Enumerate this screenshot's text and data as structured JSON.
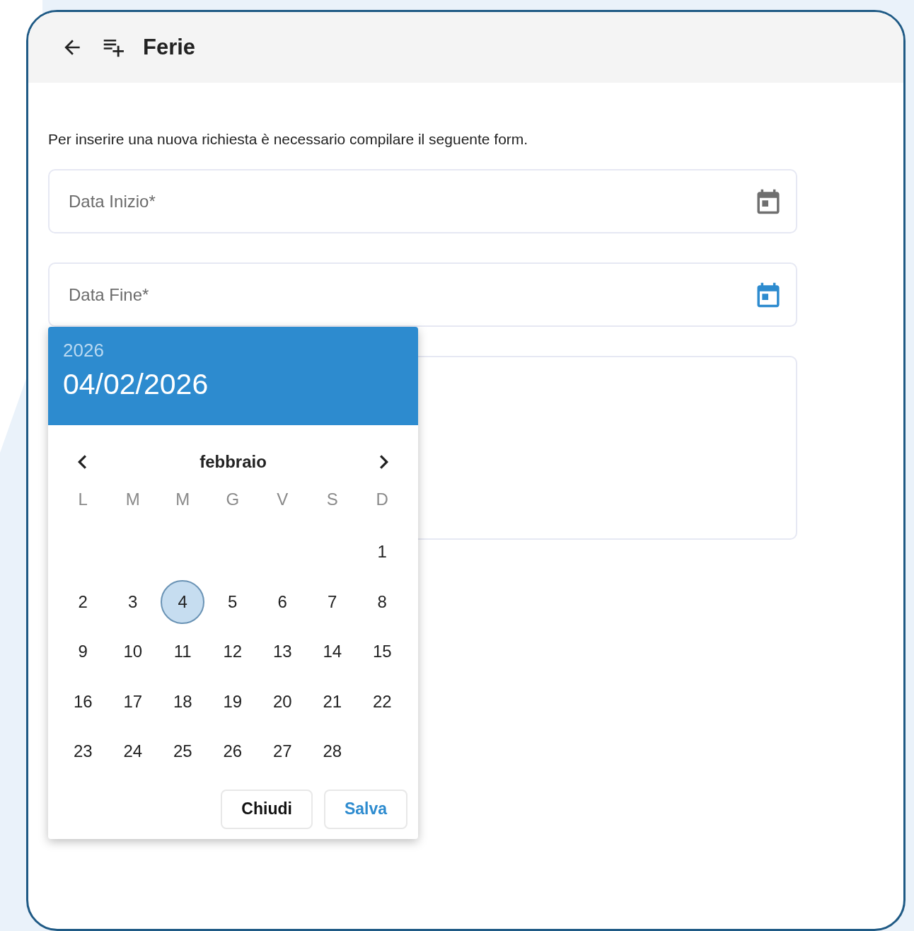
{
  "header": {
    "title": "Ferie"
  },
  "intro": "Per inserire una nuova richiesta è necessario compilare il seguente form.",
  "fields": [
    {
      "kind": "date",
      "placeholder": "Data Inizio*",
      "focused": false
    },
    {
      "kind": "date",
      "placeholder": "Data Fine*",
      "focused": true
    },
    {
      "kind": "textarea"
    }
  ],
  "datepicker": {
    "year": "2026",
    "selected_date": "04/02/2026",
    "month": "febbraio",
    "weekdays": [
      "L",
      "M",
      "M",
      "G",
      "V",
      "S",
      "D"
    ],
    "weeks": [
      [
        {
          "kind": "blank"
        },
        {
          "kind": "blank"
        },
        {
          "kind": "blank"
        },
        {
          "kind": "blank"
        },
        {
          "kind": "blank"
        },
        {
          "kind": "blank"
        },
        {
          "kind": "day",
          "label": "1",
          "selected": false
        }
      ],
      [
        {
          "kind": "day",
          "label": "2",
          "selected": false
        },
        {
          "kind": "day",
          "label": "3",
          "selected": false
        },
        {
          "kind": "day",
          "label": "4",
          "selected": true
        },
        {
          "kind": "day",
          "label": "5",
          "selected": false
        },
        {
          "kind": "day",
          "label": "6",
          "selected": false
        },
        {
          "kind": "day",
          "label": "7",
          "selected": false
        },
        {
          "kind": "day",
          "label": "8",
          "selected": false
        }
      ],
      [
        {
          "kind": "day",
          "label": "9",
          "selected": false
        },
        {
          "kind": "day",
          "label": "10",
          "selected": false
        },
        {
          "kind": "day",
          "label": "11",
          "selected": false
        },
        {
          "kind": "day",
          "label": "12",
          "selected": false
        },
        {
          "kind": "day",
          "label": "13",
          "selected": false
        },
        {
          "kind": "day",
          "label": "14",
          "selected": false
        },
        {
          "kind": "day",
          "label": "15",
          "selected": false
        }
      ],
      [
        {
          "kind": "day",
          "label": "16",
          "selected": false
        },
        {
          "kind": "day",
          "label": "17",
          "selected": false
        },
        {
          "kind": "day",
          "label": "18",
          "selected": false
        },
        {
          "kind": "day",
          "label": "19",
          "selected": false
        },
        {
          "kind": "day",
          "label": "20",
          "selected": false
        },
        {
          "kind": "day",
          "label": "21",
          "selected": false
        },
        {
          "kind": "day",
          "label": "22",
          "selected": false
        }
      ],
      [
        {
          "kind": "day",
          "label": "23",
          "selected": false
        },
        {
          "kind": "day",
          "label": "24",
          "selected": false
        },
        {
          "kind": "day",
          "label": "25",
          "selected": false
        },
        {
          "kind": "day",
          "label": "26",
          "selected": false
        },
        {
          "kind": "day",
          "label": "27",
          "selected": false
        },
        {
          "kind": "day",
          "label": "28",
          "selected": false
        },
        {
          "kind": "blank"
        }
      ]
    ],
    "buttons": [
      {
        "label": "Chiudi",
        "kind": "secondary"
      },
      {
        "label": "Salva",
        "kind": "primary"
      }
    ]
  }
}
